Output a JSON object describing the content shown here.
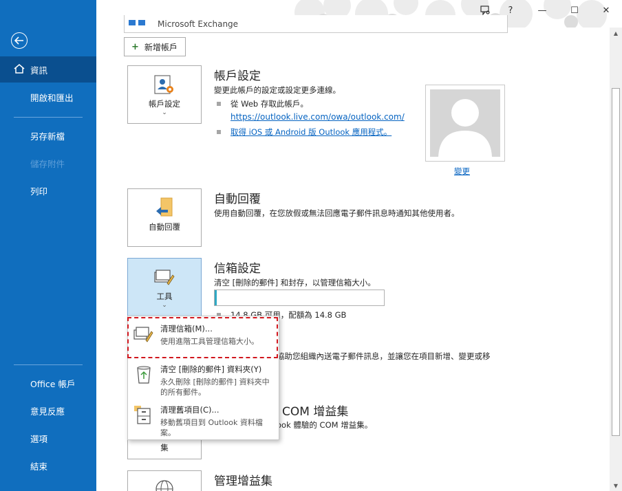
{
  "window": {
    "controls": [
      "?",
      "—",
      "☐",
      "✕"
    ]
  },
  "sidebar": {
    "items": [
      {
        "label": "資訊",
        "state": "active"
      },
      {
        "label": "開啟和匯出",
        "state": "normal"
      },
      {
        "label": "另存新檔",
        "state": "normal"
      },
      {
        "label": "儲存附件",
        "state": "disabled"
      },
      {
        "label": "列印",
        "state": "normal"
      },
      {
        "label": "Office 帳戶",
        "state": "normal"
      },
      {
        "label": "意見反應",
        "state": "normal"
      },
      {
        "label": "選項",
        "state": "normal"
      },
      {
        "label": "結束",
        "state": "normal"
      }
    ]
  },
  "account": {
    "exchange_label": "Microsoft Exchange",
    "add_account_label": "新增帳戶"
  },
  "account_settings": {
    "tile_label": "帳戶設定",
    "title": "帳戶設定",
    "desc": "變更此帳戶的設定或設定更多連線。",
    "bullet1": "從 Web 存取此帳戶。",
    "link1": "https://outlook.live.com/owa/outlook.com/",
    "link2": "取得 iOS 或 Android 版 Outlook 應用程式。",
    "change_label": "變更"
  },
  "auto_reply": {
    "tile_label": "自動回覆",
    "title": "自動回覆",
    "desc": "使用自動回覆，在您放假或無法回應電子郵件訊息時通知其他使用者。"
  },
  "mailbox": {
    "tile_label": "工具",
    "title": "信箱設定",
    "desc": "清空 [刪除的郵件] 和封存，以管理信箱大小。",
    "quota_text": "14.8 GB 可用，配額為 14.8 GB",
    "quota_used_fraction": 0.01
  },
  "rules_partial": {
    "desc": "協助您組織內送電子郵件訊息，並讓您在項目新增、變更或移"
  },
  "com_addins": {
    "title_partial": "COM 增益集",
    "desc_partial": "ook 體驗的 COM 增益集。",
    "tile_label_partial": "集"
  },
  "manage_addins": {
    "title": "管理增益集"
  },
  "tools_menu": {
    "items": [
      {
        "title": "清理信箱(M)...",
        "desc": "使用進階工具管理信箱大小。"
      },
      {
        "title": "清空 [刪除的郵件] 資料夾(Y)",
        "desc": "永久刪除 [刪除的郵件] 資料夾中的所有郵件。"
      },
      {
        "title": "清理舊項目(C)...",
        "desc": "移動舊項目到 Outlook 資料檔案。"
      }
    ]
  },
  "colors": {
    "sidebar": "#106ebe",
    "sidebar_active": "#0a4f8f",
    "link": "#0563c1",
    "highlight": "#d0161d"
  }
}
